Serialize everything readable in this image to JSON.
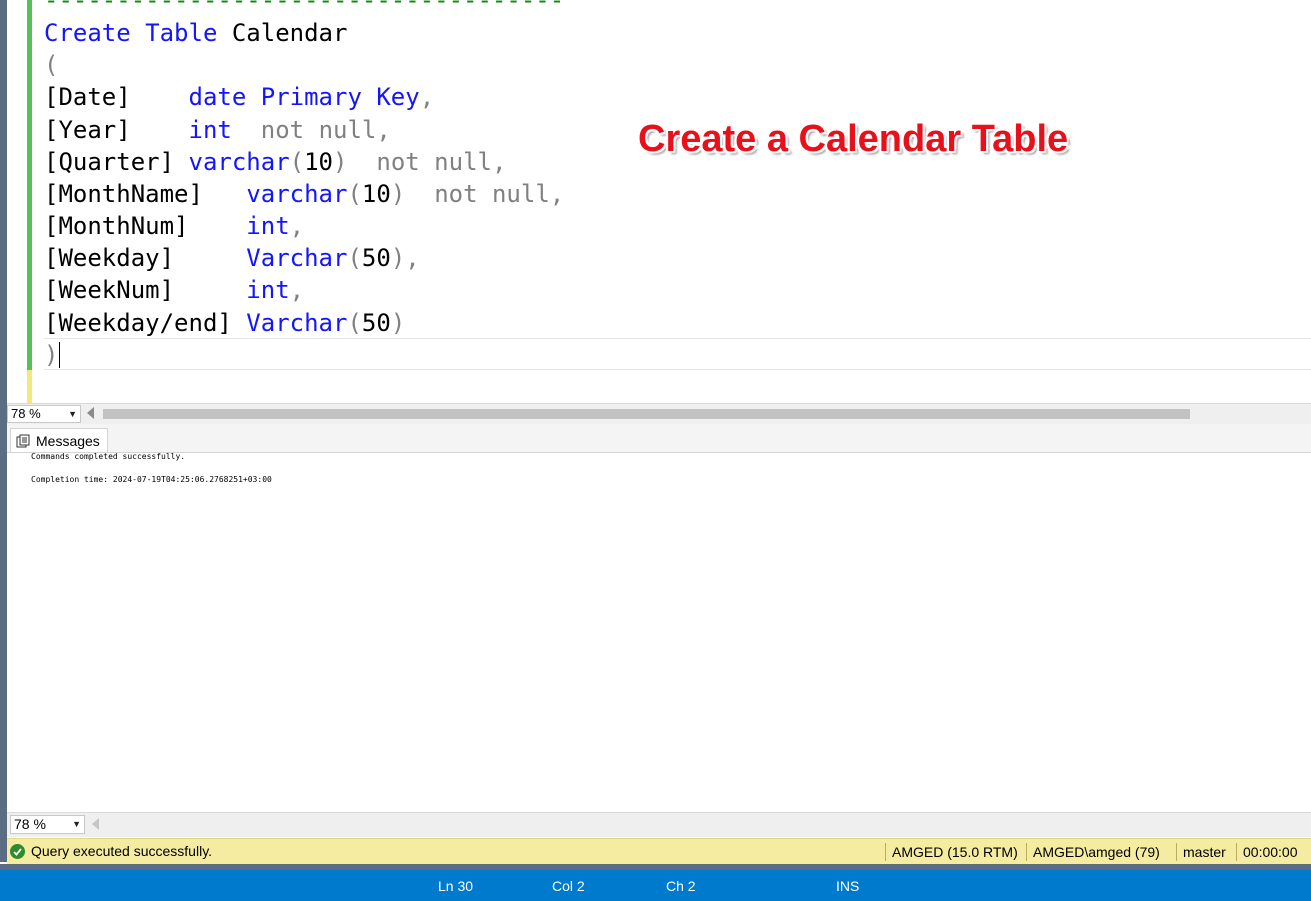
{
  "editor": {
    "lines": [
      [
        {
          "t": "------------------------------------",
          "c": "cmt"
        }
      ],
      [
        {
          "t": "Create",
          "c": "kw"
        },
        {
          "t": " ",
          "c": "id"
        },
        {
          "t": "Table",
          "c": "kw"
        },
        {
          "t": " Calendar",
          "c": "id"
        }
      ],
      [
        {
          "t": "(",
          "c": "gray"
        }
      ],
      [
        {
          "t": "[Date]",
          "c": "id"
        },
        {
          "t": "    ",
          "c": "id"
        },
        {
          "t": "date",
          "c": "kw"
        },
        {
          "t": " ",
          "c": "id"
        },
        {
          "t": "Primary",
          "c": "kw"
        },
        {
          "t": " ",
          "c": "id"
        },
        {
          "t": "Key",
          "c": "kw"
        },
        {
          "t": ",",
          "c": "gray"
        }
      ],
      [
        {
          "t": "[Year]",
          "c": "id"
        },
        {
          "t": "    ",
          "c": "id"
        },
        {
          "t": "int",
          "c": "kw"
        },
        {
          "t": "  ",
          "c": "id"
        },
        {
          "t": "not null,",
          "c": "gray"
        }
      ],
      [
        {
          "t": "[Quarter]",
          "c": "id"
        },
        {
          "t": " ",
          "c": "id"
        },
        {
          "t": "varchar",
          "c": "kw"
        },
        {
          "t": "(",
          "c": "gray"
        },
        {
          "t": "10",
          "c": "num"
        },
        {
          "t": ")",
          "c": "gray"
        },
        {
          "t": "  ",
          "c": "id"
        },
        {
          "t": "not null,",
          "c": "gray"
        }
      ],
      [
        {
          "t": "[MonthName]",
          "c": "id"
        },
        {
          "t": "   ",
          "c": "id"
        },
        {
          "t": "varchar",
          "c": "kw"
        },
        {
          "t": "(",
          "c": "gray"
        },
        {
          "t": "10",
          "c": "num"
        },
        {
          "t": ")",
          "c": "gray"
        },
        {
          "t": "  ",
          "c": "id"
        },
        {
          "t": "not null,",
          "c": "gray"
        }
      ],
      [
        {
          "t": "[MonthNum]",
          "c": "id"
        },
        {
          "t": "    ",
          "c": "id"
        },
        {
          "t": "int",
          "c": "kw"
        },
        {
          "t": ",",
          "c": "gray"
        }
      ],
      [
        {
          "t": "[Weekday]",
          "c": "id"
        },
        {
          "t": "     ",
          "c": "id"
        },
        {
          "t": "Varchar",
          "c": "kw"
        },
        {
          "t": "(",
          "c": "gray"
        },
        {
          "t": "50",
          "c": "num"
        },
        {
          "t": "),",
          "c": "gray"
        }
      ],
      [
        {
          "t": "[WeekNum]",
          "c": "id"
        },
        {
          "t": "     ",
          "c": "id"
        },
        {
          "t": "int",
          "c": "kw"
        },
        {
          "t": ",",
          "c": "gray"
        }
      ],
      [
        {
          "t": "[Weekday/end]",
          "c": "id"
        },
        {
          "t": " ",
          "c": "id"
        },
        {
          "t": "Varchar",
          "c": "kw"
        },
        {
          "t": "(",
          "c": "gray"
        },
        {
          "t": "50",
          "c": "num"
        },
        {
          "t": ")",
          "c": "gray"
        }
      ],
      [
        {
          "t": ")",
          "c": "gray"
        }
      ]
    ],
    "zoom": "78 %"
  },
  "overlay": {
    "title": "Create a Calendar Table"
  },
  "results": {
    "tab_label": "Messages",
    "messages": [
      "Commands completed successfully.",
      "Completion time: 2024-07-19T04:25:06.2768251+03:00"
    ],
    "zoom": "78 %"
  },
  "query_status": {
    "message": "Query executed successfully.",
    "server": "AMGED (15.0 RTM)",
    "user": "AMGED\\amged (79)",
    "database": "master",
    "elapsed": "00:00:00"
  },
  "statusbar": {
    "ln": "Ln 30",
    "col": "Col 2",
    "ch": "Ch 2",
    "mode": "INS"
  },
  "colors": {
    "keyword": "#1414ff",
    "gray": "#808080",
    "comment": "#0d8a0d",
    "overlay_title": "#e8111b",
    "statusbar": "#007acc",
    "query_status_bg": "#f6eca1"
  }
}
